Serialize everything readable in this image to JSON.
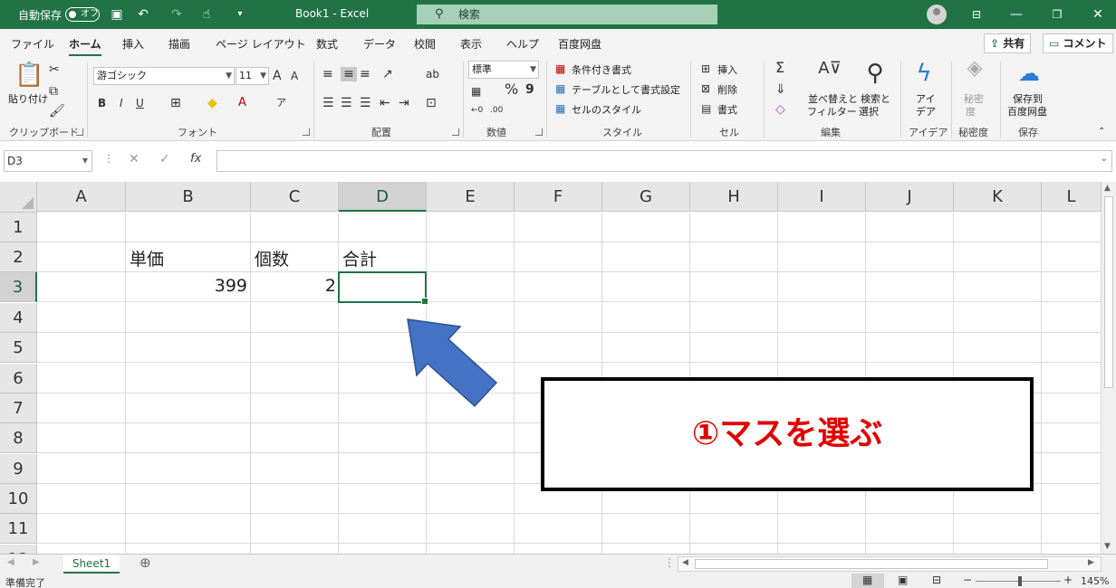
{
  "titlebar": {
    "autosave": "自動保存",
    "toggle": "オフ",
    "doc_title": "Book1  -  Excel",
    "search_placeholder": "検索"
  },
  "tabs": [
    "ファイル",
    "ホーム",
    "挿入",
    "描画",
    "ページ レイアウト",
    "数式",
    "データ",
    "校閲",
    "表示",
    "ヘルプ",
    "百度网盘"
  ],
  "active_tab": "ホーム",
  "share_label": "共有",
  "comment_label": "コメント",
  "ribbon": {
    "clipboard": {
      "paste": "貼り付け",
      "label": "クリップボード"
    },
    "font": {
      "name": "游ゴシック",
      "size": "11",
      "label": "フォント",
      "bold": "B",
      "italic": "I",
      "underline": "U"
    },
    "alignment": {
      "label": "配置"
    },
    "number": {
      "format": "標準",
      "label": "数値",
      "percent": "%",
      "comma": "9"
    },
    "styles": {
      "conditional": "条件付き書式",
      "table": "テーブルとして書式設定",
      "cell_styles": "セルのスタイル",
      "label": "スタイル"
    },
    "cells": {
      "insert": "挿入",
      "delete": "削除",
      "format": "書式",
      "label": "セル"
    },
    "editing": {
      "sort": "並べ替えと",
      "sort2": "フィルター",
      "find": "検索と",
      "find2": "選択",
      "label": "編集"
    },
    "ideas": {
      "btn1": "アイ",
      "btn2": "デア",
      "label": "アイデア"
    },
    "sensitivity": {
      "btn1": "秘密",
      "btn2": "度",
      "label": "秘密度"
    },
    "save": {
      "btn1": "保存到",
      "btn2": "百度网盘",
      "label": "保存"
    }
  },
  "formula_bar": {
    "name_box": "D3",
    "fx": "fx",
    "formula": ""
  },
  "columns": [
    "A",
    "B",
    "C",
    "D",
    "E",
    "F",
    "G",
    "H",
    "I",
    "J",
    "K",
    "L"
  ],
  "selected_column": "D",
  "rows": [
    "1",
    "2",
    "3",
    "4",
    "5",
    "6",
    "7",
    "8",
    "9",
    "10",
    "11",
    "12"
  ],
  "selected_row": "3",
  "cells": {
    "B2": "単価",
    "C2": "個数",
    "D2": "合計",
    "B3": "399",
    "C3": "2"
  },
  "sheet_tab": "Sheet1",
  "status": {
    "ready": "準備完了",
    "zoom": "145%"
  },
  "callout": {
    "text": "①マスを選ぶ"
  },
  "colors": {
    "accent": "#217346",
    "arrow": "#4472c4",
    "callout_text": "#e00000"
  }
}
